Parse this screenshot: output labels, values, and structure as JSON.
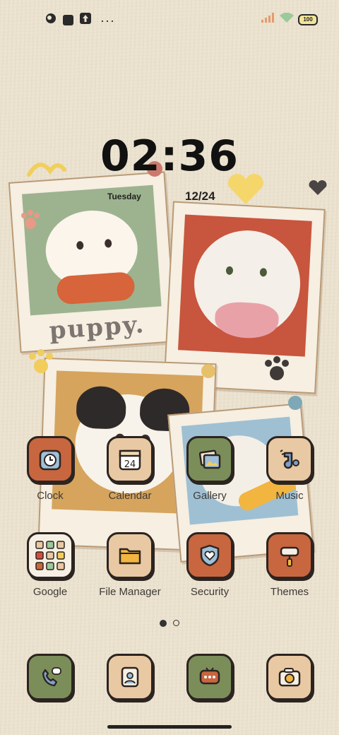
{
  "status_bar": {
    "left_icons": [
      "app-notification-icon",
      "square-notification-icon",
      "upload-notification-icon"
    ],
    "more": "···",
    "battery": "100"
  },
  "lockclock": {
    "time": "02:36",
    "weekday": "Tuesday",
    "date": "12/24"
  },
  "wallpaper": {
    "caption": "puppy."
  },
  "apps": [
    {
      "label": "Clock",
      "icon": "clock-icon",
      "color": "#c8663f"
    },
    {
      "label": "Calendar",
      "icon": "calendar-icon",
      "day": "24",
      "color": "#e9c9a3"
    },
    {
      "label": "Gallery",
      "icon": "gallery-icon",
      "color": "#7b8e5a"
    },
    {
      "label": "Music",
      "icon": "music-icon",
      "color": "#e9c9a3"
    },
    {
      "label": "Google",
      "icon": "google-folder-icon",
      "color": "#f6f0e4"
    },
    {
      "label": "File Manager",
      "icon": "folder-icon",
      "color": "#e9c9a3"
    },
    {
      "label": "Security",
      "icon": "security-shield-icon",
      "color": "#c8663f"
    },
    {
      "label": "Themes",
      "icon": "paint-roller-icon",
      "color": "#c8663f"
    }
  ],
  "pager": {
    "pages": 2,
    "current": 1
  },
  "dock": [
    {
      "icon": "phone-icon",
      "color": "#7b8e5a"
    },
    {
      "icon": "contacts-icon",
      "color": "#e9c9a3"
    },
    {
      "icon": "messages-icon",
      "color": "#7b8e5a"
    },
    {
      "icon": "camera-icon",
      "color": "#e9c9a3"
    }
  ]
}
